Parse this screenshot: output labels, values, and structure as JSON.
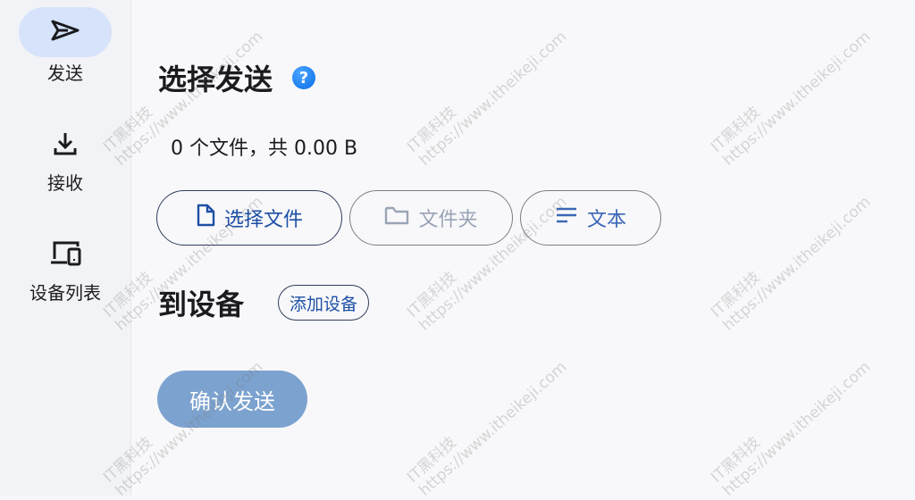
{
  "sidebar": {
    "items": [
      {
        "label": "发送",
        "icon": "send-icon",
        "active": true
      },
      {
        "label": "接收",
        "icon": "download-icon",
        "active": false
      },
      {
        "label": "设备列表",
        "icon": "devices-icon",
        "active": false
      }
    ]
  },
  "main": {
    "title": "选择发送",
    "help": "?",
    "summary": "0 个文件，共 0.00 B",
    "buttons": {
      "files": "选择文件",
      "folder": "文件夹",
      "text": "文本"
    },
    "devices_title": "到设备",
    "add_device": "添加设备",
    "confirm": "确认发送"
  },
  "watermark": {
    "brand": "IT黑科技",
    "url": "https://www.itheikeji.com"
  },
  "colors": {
    "accent": "#1d4fa6",
    "active_nav": "#d6e3fb",
    "confirm_disabled": "#7ca2cf",
    "help_icon": "#0a6ee8"
  }
}
